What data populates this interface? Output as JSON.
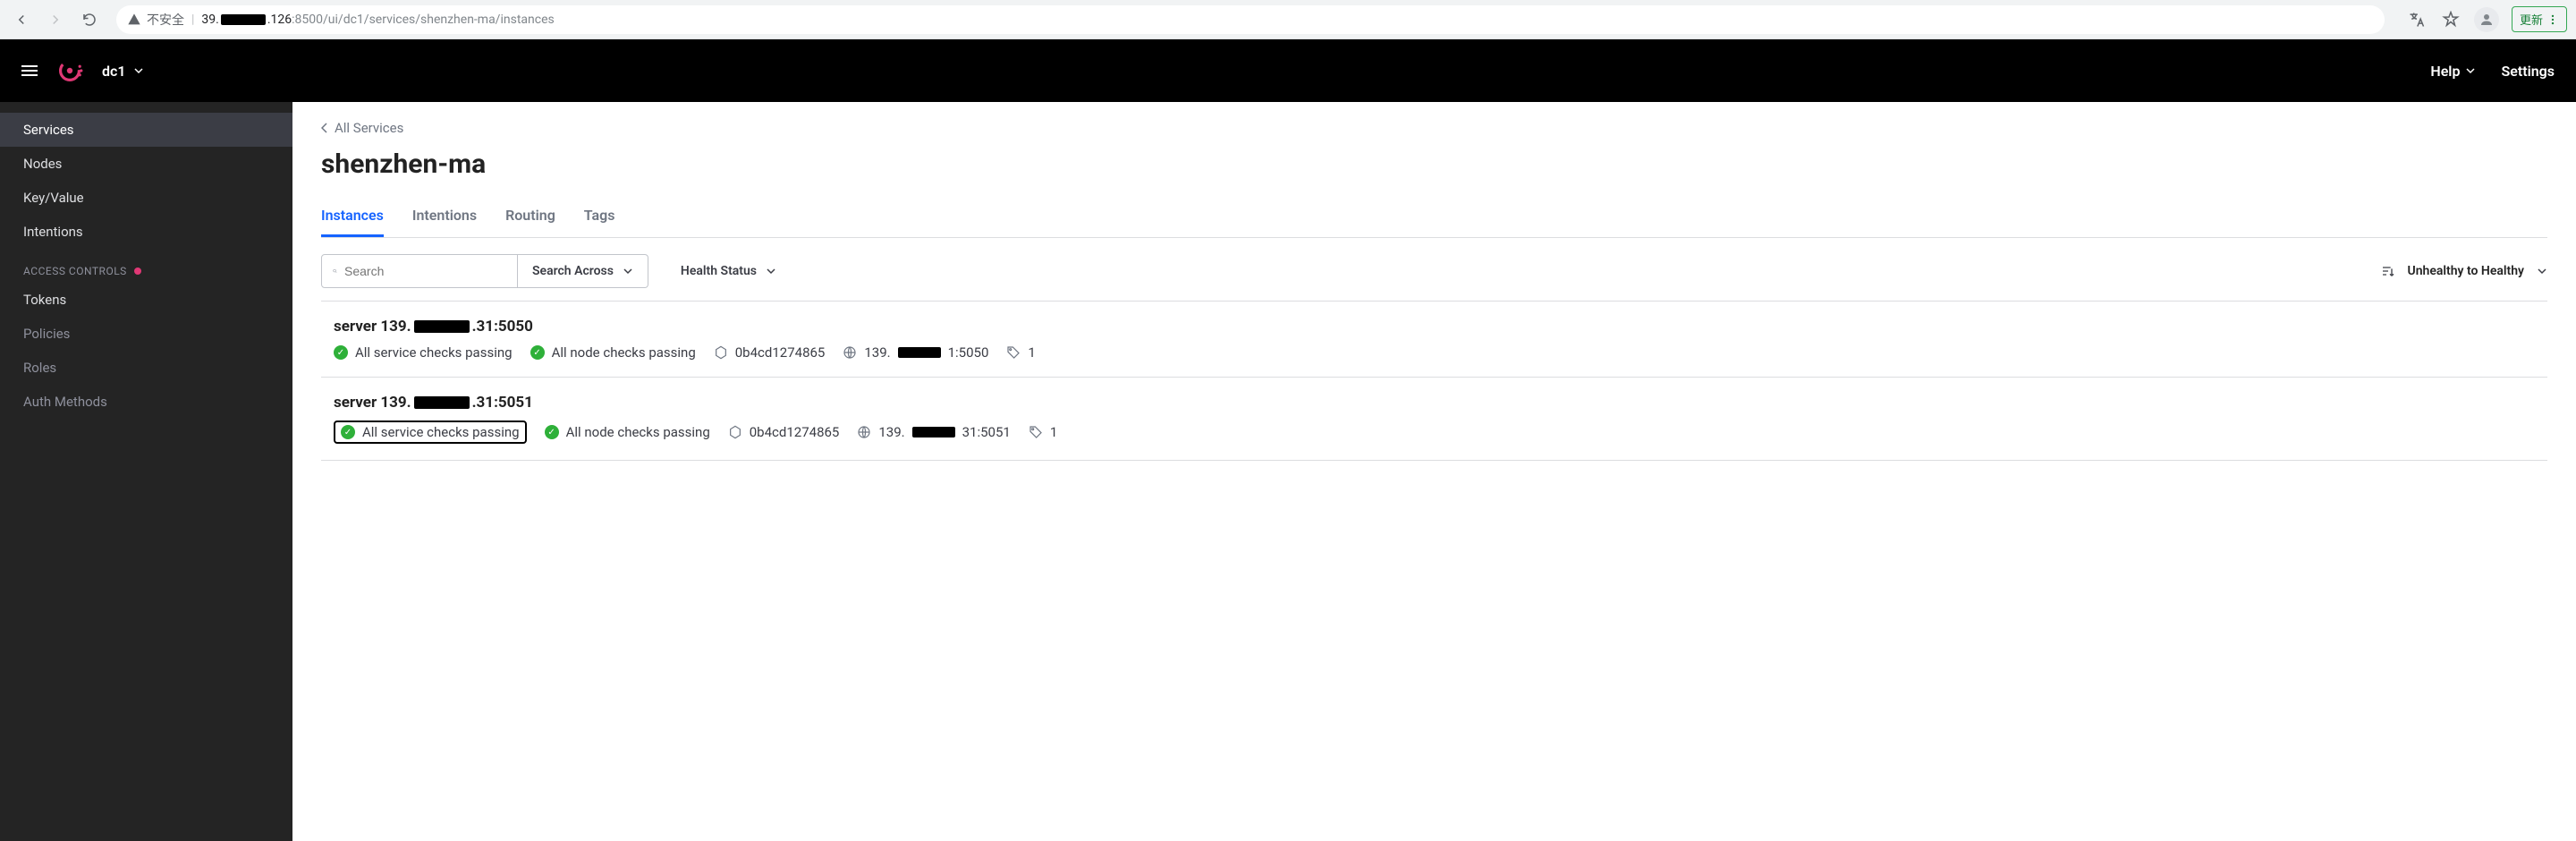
{
  "browser": {
    "security_label": "不安全",
    "url_prefix": "39.",
    "url_mid": ".126",
    "url_rest": ":8500/ui/dc1/services/shenzhen-ma/instances",
    "update_label": "更新"
  },
  "header": {
    "datacenter": "dc1",
    "help": "Help",
    "settings": "Settings"
  },
  "sidebar": {
    "items": [
      {
        "label": "Services",
        "active": true,
        "dim": false
      },
      {
        "label": "Nodes",
        "active": false,
        "dim": false
      },
      {
        "label": "Key/Value",
        "active": false,
        "dim": false
      },
      {
        "label": "Intentions",
        "active": false,
        "dim": false
      }
    ],
    "section_label": "ACCESS CONTROLS",
    "access_items": [
      {
        "label": "Tokens",
        "dim": false
      },
      {
        "label": "Policies",
        "dim": true
      },
      {
        "label": "Roles",
        "dim": true
      },
      {
        "label": "Auth Methods",
        "dim": true
      }
    ]
  },
  "main": {
    "breadcrumb_back": "All Services",
    "title": "shenzhen-ma",
    "tabs": [
      {
        "label": "Instances",
        "active": true
      },
      {
        "label": "Intentions",
        "active": false
      },
      {
        "label": "Routing",
        "active": false
      },
      {
        "label": "Tags",
        "active": false
      }
    ],
    "search_placeholder": "Search",
    "search_across": "Search Across",
    "health_status": "Health Status",
    "sort_label": "Unhealthy to Healthy",
    "instances": [
      {
        "name_prefix": "server 139.",
        "name_suffix": ".31:5050",
        "service_checks": "All service checks passing",
        "node_checks": "All node checks passing",
        "node_id": "0b4cd1274865",
        "addr_prefix": "139.",
        "addr_suffix": "1:5050",
        "tag_count": "1",
        "highlight": false
      },
      {
        "name_prefix": "server 139.",
        "name_suffix": ".31:5051",
        "service_checks": "All service checks passing",
        "node_checks": "All node checks passing",
        "node_id": "0b4cd1274865",
        "addr_prefix": "139.",
        "addr_suffix": "31:5051",
        "tag_count": "1",
        "highlight": true
      }
    ]
  }
}
